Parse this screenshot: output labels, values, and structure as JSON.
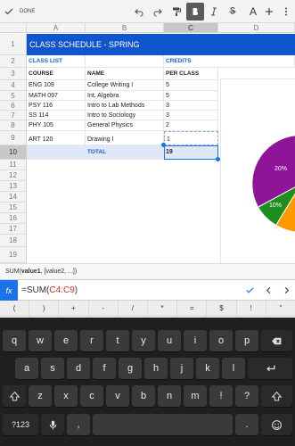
{
  "toolbar": {
    "done_label": "DONE",
    "font_size_label": "A",
    "buttons": [
      "undo",
      "redo",
      "format-paint",
      "bold",
      "italic",
      "strikethrough",
      "text-size",
      "add",
      "more"
    ]
  },
  "grid": {
    "columns": [
      "A",
      "B",
      "C",
      "D"
    ],
    "rows": [
      "1",
      "2",
      "3",
      "4",
      "5",
      "6",
      "7",
      "8",
      "9",
      "10",
      "11",
      "12",
      "13",
      "14",
      "15",
      "16",
      "17",
      "18",
      "19"
    ],
    "title": "CLASS SCHEDULE - SPRING",
    "class_list_label": "CLASS LIST",
    "credits_label": "CREDITS",
    "headers": {
      "course": "COURSE",
      "name": "NAME",
      "per_class": "PER CLASS"
    },
    "classes": [
      {
        "course": "ENG 109",
        "name": "College Writing I",
        "credits": "5"
      },
      {
        "course": "MATH 097",
        "name": "Int. Algebra",
        "credits": "5"
      },
      {
        "course": "PSY 116",
        "name": "Intro to Lab Methods",
        "credits": "3"
      },
      {
        "course": "SS 114",
        "name": "Intro to Sociology",
        "credits": "3"
      },
      {
        "course": "PHY 105",
        "name": "General Physics",
        "credits": "2"
      },
      {
        "course": "ART 120",
        "name": "Drawing I",
        "credits": "1"
      }
    ],
    "total_label": "TOTAL",
    "total_value": "19",
    "chart_labels": {
      "pct1": "20%",
      "pct2": "10%"
    }
  },
  "colors": {
    "header_blue": "#1155cc",
    "label_blue": "#1a5fd0",
    "selection": "#1a73e8",
    "pie_purple": "#8e1597",
    "pie_green": "#1e8f1e",
    "pie_orange": "#ff9900"
  },
  "hint": {
    "fn": "SUM(",
    "arg1": "value1",
    "rest": ", [value2, ...])"
  },
  "formula": {
    "prefix": "=SUM(",
    "ref": "C4:C9",
    "suffix": ")",
    "fx_label": "fx"
  },
  "symbols": [
    "(",
    ")",
    "+",
    "-",
    "/",
    "*",
    "=",
    "$",
    "!",
    "\""
  ],
  "keyboard": {
    "row1": [
      "q",
      "w",
      "e",
      "r",
      "t",
      "y",
      "u",
      "i",
      "o",
      "p"
    ],
    "row2": [
      "a",
      "s",
      "d",
      "f",
      "g",
      "h",
      "j",
      "k",
      "l"
    ],
    "row3": [
      "z",
      "x",
      "c",
      "v",
      "b",
      "n",
      "m",
      "!",
      "?"
    ],
    "mode_label": "?123",
    "space_label": "",
    "comma": ",",
    "period": "."
  }
}
